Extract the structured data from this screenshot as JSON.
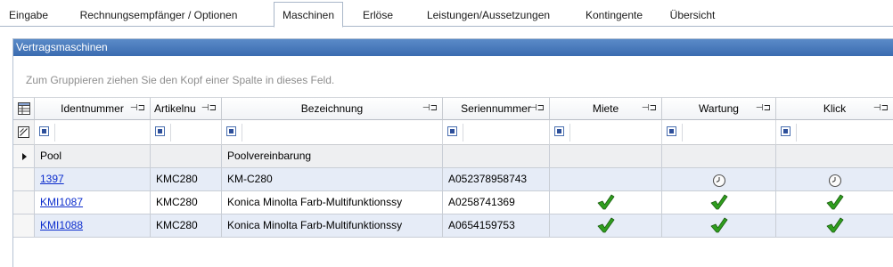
{
  "tabs": [
    {
      "label": "Eingabe",
      "active": false
    },
    {
      "label": "Rechnungsempfänger / Optionen",
      "active": false
    },
    {
      "label": "Maschinen",
      "active": true
    },
    {
      "label": "Erlöse",
      "active": false
    },
    {
      "label": "Leistungen/Aussetzungen",
      "active": false
    },
    {
      "label": "Kontingente",
      "active": false
    },
    {
      "label": "Übersicht",
      "active": false
    }
  ],
  "panel": {
    "caption": "Vertragsmaschinen",
    "group_hint": "Zum Gruppieren ziehen Sie den Kopf einer Spalte in dieses Feld."
  },
  "columns": [
    {
      "label": "Identnummer"
    },
    {
      "label": "Artikelnu"
    },
    {
      "label": "Bezeichnung"
    },
    {
      "label": "Seriennummer"
    },
    {
      "label": "Miete"
    },
    {
      "label": "Wartung"
    },
    {
      "label": "Klick"
    }
  ],
  "icons": {
    "column_chooser": "column-chooser-icon",
    "filter_clear": "filter-clear-icon",
    "pin": "pin-icon",
    "checkmark": "checkmark-icon",
    "clock": "clock-icon"
  },
  "colors": {
    "tab_border": "#a9b7c9",
    "caption_bg": "#4a7cbf",
    "row_alt": "#e6ecf7",
    "row_white": "#ffffff",
    "pool_row": "#eeeff1",
    "link": "#0b2ccd",
    "check_green": "#2f9e1e"
  },
  "rows": [
    {
      "ident": "Pool",
      "ident_link": false,
      "artikel": "",
      "bezeichnung": "Poolvereinbarung",
      "serien": "",
      "miete": "",
      "wartung": "",
      "klick": "",
      "current": true
    },
    {
      "ident": "1397",
      "ident_link": true,
      "artikel": "KMC280",
      "bezeichnung": "KM-C280",
      "serien": "A052378958743",
      "miete": "",
      "wartung": "clock",
      "klick": "clock",
      "current": false
    },
    {
      "ident": "KMI1087",
      "ident_link": true,
      "artikel": "KMC280",
      "bezeichnung": "Konica Minolta Farb-Multifunktionssy",
      "serien": "A0258741369",
      "miete": "check",
      "wartung": "check",
      "klick": "check",
      "current": false
    },
    {
      "ident": "KMI1088",
      "ident_link": true,
      "artikel": "KMC280",
      "bezeichnung": "Konica Minolta Farb-Multifunktionssy",
      "serien": "A0654159753",
      "miete": "check",
      "wartung": "check",
      "klick": "check",
      "current": false
    }
  ]
}
